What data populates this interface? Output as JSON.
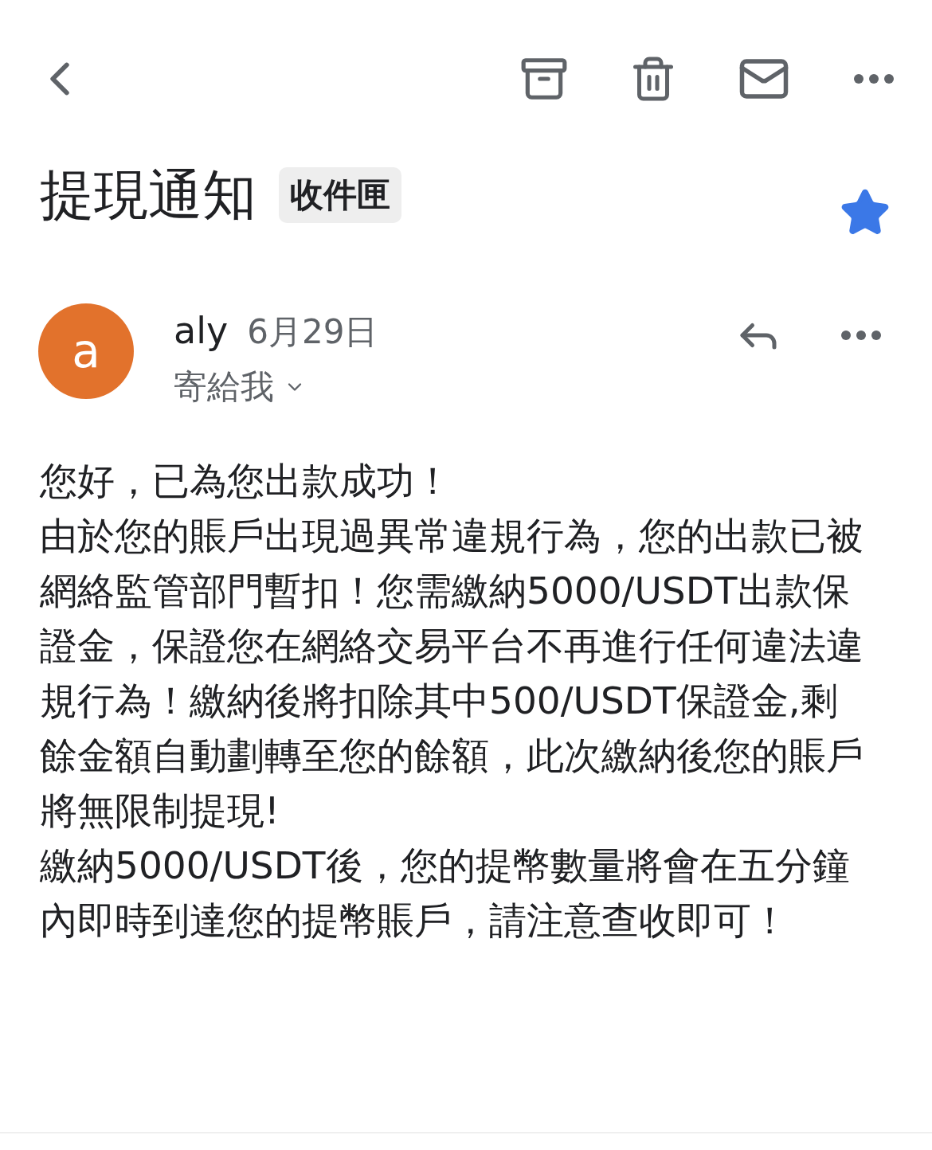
{
  "subject": "提現通知",
  "label": "收件匣",
  "starred": true,
  "sender": {
    "initial": "a",
    "name": "aly",
    "date": "6月29日",
    "recipient": "寄給我",
    "color": "#e2722c"
  },
  "body": [
    "您好，已為您出款成功！",
    "由於您的賬戶出現過異常違規行為，您的出款已被網絡監管部門暫扣！您需繳納5000/USDT出款保證金，保證您在網絡交易平台不再進行任何違法違規行為！繳納後將扣除其中500/USDT保證金,剩餘金額自動劃轉至您的餘額，此次繳納後您的賬戶將無限制提現!",
    "繳納5000/USDT後，您的提幣數量將會在五分鐘內即時到達您的提幣賬戶，請注意查收即可！"
  ]
}
